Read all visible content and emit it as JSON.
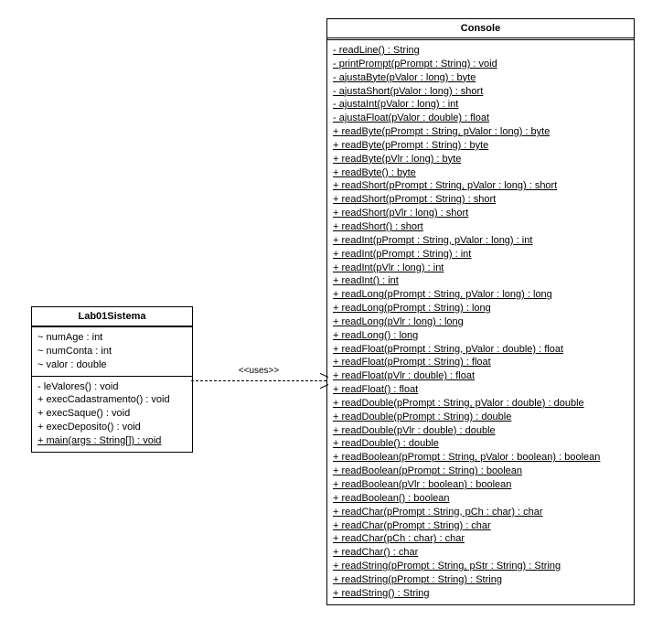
{
  "classes": {
    "lab01": {
      "name": "Lab01Sistema",
      "attributes": [
        {
          "text": "~ numAge : int",
          "static": false
        },
        {
          "text": "~ numConta : int",
          "static": false
        },
        {
          "text": "~ valor : double",
          "static": false
        }
      ],
      "operations": [
        {
          "text": "- leValores() : void",
          "static": false
        },
        {
          "text": "+ execCadastramento() : void",
          "static": false
        },
        {
          "text": "+ execSaque() : void",
          "static": false
        },
        {
          "text": "+ execDeposito() : void",
          "static": false
        },
        {
          "text": "+ main(args : String[]) : void",
          "static": true
        }
      ]
    },
    "console": {
      "name": "Console",
      "operations": [
        {
          "text": "- readLine() : String",
          "static": true
        },
        {
          "text": "- printPrompt(pPrompt : String) : void",
          "static": true
        },
        {
          "text": "- ajustaByte(pValor : long) : byte",
          "static": true
        },
        {
          "text": "- ajustaShort(pValor : long) : short",
          "static": true
        },
        {
          "text": "- ajustaInt(pValor : long) : int",
          "static": true
        },
        {
          "text": "- ajustaFloat(pValor : double) : float",
          "static": true
        },
        {
          "text": "+ readByte(pPrompt : String, pValor : long) : byte",
          "static": true
        },
        {
          "text": "+ readByte(pPrompt : String) : byte",
          "static": true
        },
        {
          "text": "+ readByte(pVlr : long) : byte",
          "static": true
        },
        {
          "text": "+ readByte() : byte",
          "static": true
        },
        {
          "text": "+ readShort(pPrompt : String, pValor : long) : short",
          "static": true
        },
        {
          "text": "+ readShort(pPrompt : String) : short",
          "static": true
        },
        {
          "text": "+ readShort(pVlr : long) : short",
          "static": true
        },
        {
          "text": "+ readShort() : short",
          "static": true
        },
        {
          "text": "+ readInt(pPrompt : String, pValor : long) : int",
          "static": true
        },
        {
          "text": "+ readInt(pPrompt : String) : int",
          "static": true
        },
        {
          "text": "+ readInt(pVlr : long) : int",
          "static": true
        },
        {
          "text": "+ readInt() : int",
          "static": true
        },
        {
          "text": "+ readLong(pPrompt : String, pValor : long) : long",
          "static": true
        },
        {
          "text": "+ readLong(pPrompt : String) : long",
          "static": true
        },
        {
          "text": "+ readLong(pVlr : long) : long",
          "static": true
        },
        {
          "text": "+ readLong() : long",
          "static": true
        },
        {
          "text": "+ readFloat(pPrompt : String, pValor : double) : float",
          "static": true
        },
        {
          "text": "+ readFloat(pPrompt : String) : float",
          "static": true
        },
        {
          "text": "+ readFloat(pVlr : double) : float",
          "static": true
        },
        {
          "text": "+ readFloat() : float",
          "static": true
        },
        {
          "text": "+ readDouble(pPrompt : String, pValor : double) : double",
          "static": true
        },
        {
          "text": "+ readDouble(pPrompt : String) : double",
          "static": true
        },
        {
          "text": "+ readDouble(pVlr : double) : double",
          "static": true
        },
        {
          "text": "+ readDouble() : double",
          "static": true
        },
        {
          "text": "+ readBoolean(pPrompt : String, pValor : boolean) : boolean",
          "static": true
        },
        {
          "text": "+ readBoolean(pPrompt : String) : boolean",
          "static": true
        },
        {
          "text": "+ readBoolean(pVlr : boolean) : boolean",
          "static": true
        },
        {
          "text": "+ readBoolean() : boolean",
          "static": true
        },
        {
          "text": "+ readChar(pPrompt : String, pCh : char) : char",
          "static": true
        },
        {
          "text": "+ readChar(pPrompt : String) : char",
          "static": true
        },
        {
          "text": "+ readChar(pCh : char) : char",
          "static": true
        },
        {
          "text": "+ readChar() : char",
          "static": true
        },
        {
          "text": "+ readString(pPrompt : String, pStr : String) : String",
          "static": true
        },
        {
          "text": "+ readString(pPrompt : String) : String",
          "static": true
        },
        {
          "text": "+ readString() : String",
          "static": true
        }
      ]
    }
  },
  "relation": {
    "label": "<<uses>>"
  }
}
